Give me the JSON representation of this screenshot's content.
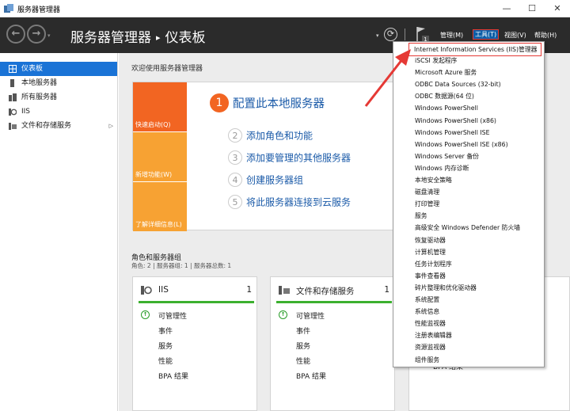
{
  "window": {
    "title": "服务器管理器",
    "minimize": "—",
    "maximize": "☐",
    "close": "✕"
  },
  "header": {
    "back_glyph": "←",
    "forward_glyph": "→",
    "app_name": "服务器管理器",
    "separator": "▸",
    "page": "仪表板",
    "refresh_glyph": "⟳",
    "dropdown_glyph": "▾",
    "flag_badge": "1",
    "menus": {
      "manage": "管理(M)",
      "tools": "工具(T)",
      "view": "视图(V)",
      "help": "帮助(H)"
    }
  },
  "sidebar": {
    "expand_glyph": "▷",
    "items": [
      {
        "label": "仪表板",
        "icon": "dashboard-icon",
        "selected": true
      },
      {
        "label": "本地服务器",
        "icon": "server-icon"
      },
      {
        "label": "所有服务器",
        "icon": "servers-icon"
      },
      {
        "label": "IIS",
        "icon": "iis-icon"
      },
      {
        "label": "文件和存储服务",
        "icon": "storage-icon",
        "expandable": true
      }
    ]
  },
  "welcome": {
    "title": "欢迎使用服务器管理器",
    "tiles": {
      "quick_start": "快速启动(Q)",
      "new_features": "新增功能(W)",
      "learn_more": "了解详细信息(L)"
    },
    "steps": [
      {
        "num": "1",
        "label": "配置此本地服务器"
      },
      {
        "num": "2",
        "label": "添加角色和功能"
      },
      {
        "num": "3",
        "label": "添加要管理的其他服务器"
      },
      {
        "num": "4",
        "label": "创建服务器组"
      },
      {
        "num": "5",
        "label": "将此服务器连接到云服务"
      }
    ]
  },
  "roles": {
    "title": "角色和服务器组",
    "subtitle": "角色: 2 | 服务器组: 1 | 服务器总数: 1",
    "status_ok_glyph": "↑",
    "cards": [
      {
        "name": "IIS",
        "count": "1",
        "rows": [
          "可管理性",
          "事件",
          "服务",
          "性能",
          "BPA 结果"
        ]
      },
      {
        "name": "文件和存储服务",
        "count": "1",
        "rows": [
          "可管理性",
          "事件",
          "服务",
          "性能",
          "BPA 结果"
        ]
      }
    ],
    "card3_rows": [
      "性能",
      "BPA 结果"
    ]
  },
  "tools_menu": {
    "items": [
      "Internet Information Services (IIS)管理器",
      "iSCSI 发起程序",
      "Microsoft Azure 服务",
      "ODBC Data Sources (32-bit)",
      "ODBC 数据源(64 位)",
      "Windows PowerShell",
      "Windows PowerShell (x86)",
      "Windows PowerShell ISE",
      "Windows PowerShell ISE (x86)",
      "Windows Server 备份",
      "Windows 内存诊断",
      "本地安全策略",
      "磁盘清理",
      "打印管理",
      "服务",
      "高级安全 Windows Defender 防火墙",
      "恢复驱动器",
      "计算机管理",
      "任务计划程序",
      "事件查看器",
      "碎片整理和优化驱动器",
      "系统配置",
      "系统信息",
      "性能监视器",
      "注册表编辑器",
      "资源监视器",
      "组件服务"
    ]
  },
  "colors": {
    "header_bg": "#2b2b2b",
    "accent": "#1a73d6",
    "orange": "#f26522",
    "light_orange": "#f7a233",
    "green": "#3cb02f",
    "annotation_red": "#e53935"
  }
}
